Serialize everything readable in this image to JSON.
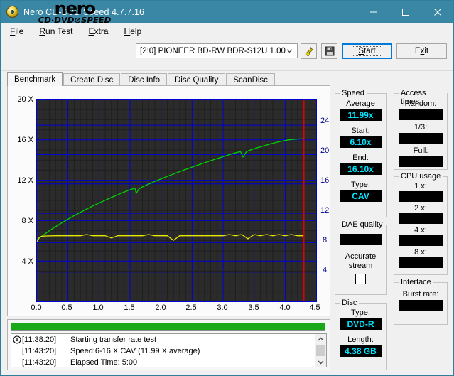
{
  "window": {
    "title": "Nero CD-DVD Speed 4.7.7.16",
    "icon": "nero-disc-icon",
    "minimize": "─",
    "maximize": "□",
    "close": "✕"
  },
  "menu": {
    "items": [
      "File",
      "Run Test",
      "Extra",
      "Help"
    ]
  },
  "toolbar": {
    "logo_main": "nero",
    "logo_sub": "CD·DVD⊘SPEED",
    "drive_value": "[2:0]  PIONEER BD-RW  BDR-S12U 1.00",
    "drive_options": [
      "[2:0]  PIONEER BD-RW  BDR-S12U 1.00"
    ],
    "plug_icon": "plug-icon",
    "save_icon": "floppy-save-icon",
    "start_label": "Start",
    "exit_label": "Exit"
  },
  "tabs": [
    {
      "label": "Benchmark",
      "active": true
    },
    {
      "label": "Create Disc",
      "active": false
    },
    {
      "label": "Disc Info",
      "active": false
    },
    {
      "label": "Disc Quality",
      "active": false
    },
    {
      "label": "ScanDisc",
      "active": false
    }
  ],
  "chart_data": {
    "type": "line",
    "title": "",
    "xlabel": "",
    "ylabel": "",
    "xlim": [
      0,
      4.5
    ],
    "ylim": [
      0,
      20
    ],
    "xticks": [
      "0.0",
      "0.5",
      "1.0",
      "1.5",
      "2.0",
      "2.5",
      "3.0",
      "3.5",
      "4.0",
      "4.5"
    ],
    "yticks_left": [
      "20 X",
      "16 X",
      "12 X",
      "8 X",
      "4 X"
    ],
    "yticks_right": [
      "24",
      "20",
      "16",
      "12",
      "8",
      "4"
    ],
    "right_axis_lim": [
      0,
      27.5
    ],
    "grid": true,
    "legend": "none",
    "plot_bg": "#2b2b2b",
    "grid_color": "#0000d4",
    "series": [
      {
        "name": "Transfer rate",
        "color": "#00d400",
        "x": [
          0.0,
          0.1,
          0.2,
          0.3,
          0.4,
          0.5,
          0.6,
          0.7,
          0.8,
          0.9,
          1.0,
          1.1,
          1.2,
          1.3,
          1.4,
          1.5,
          1.58,
          1.6,
          1.64,
          1.7,
          1.8,
          1.9,
          2.0,
          2.1,
          2.2,
          2.3,
          2.4,
          2.5,
          2.6,
          2.7,
          2.8,
          2.9,
          3.0,
          3.1,
          3.2,
          3.28,
          3.32,
          3.38,
          3.45,
          3.55,
          3.65,
          3.75,
          3.85,
          3.95,
          4.05,
          4.15,
          4.25,
          4.3
        ],
        "y": [
          6.1,
          6.55,
          7.0,
          7.4,
          7.78,
          8.15,
          8.5,
          8.82,
          9.14,
          9.45,
          9.74,
          10.02,
          10.3,
          10.56,
          10.82,
          11.06,
          11.22,
          10.7,
          11.12,
          11.34,
          11.62,
          11.88,
          12.14,
          12.38,
          12.62,
          12.86,
          13.08,
          13.3,
          13.52,
          13.73,
          13.94,
          14.14,
          14.34,
          14.53,
          14.72,
          14.84,
          14.3,
          14.85,
          15.02,
          15.22,
          15.4,
          15.58,
          15.74,
          15.88,
          16.0,
          16.06,
          16.1,
          16.1
        ]
      },
      {
        "name": "CPU / secondary",
        "color": "#e8e800",
        "x": [
          0.0,
          0.04,
          0.08,
          0.15,
          0.3,
          0.5,
          0.7,
          0.8,
          0.9,
          1.0,
          1.1,
          1.2,
          1.3,
          1.4,
          1.5,
          1.6,
          1.7,
          1.8,
          1.9,
          2.0,
          2.1,
          2.2,
          2.3,
          2.4,
          2.5,
          2.6,
          2.7,
          2.8,
          2.9,
          3.0,
          3.1,
          3.2,
          3.3,
          3.4,
          3.5,
          3.6,
          3.7,
          3.8,
          3.9,
          4.0,
          4.1,
          4.2,
          4.3
        ],
        "y": [
          5.9,
          6.35,
          6.45,
          6.48,
          6.5,
          6.5,
          6.5,
          6.62,
          6.5,
          6.5,
          6.5,
          6.28,
          6.5,
          6.5,
          6.5,
          6.5,
          6.5,
          6.62,
          6.5,
          6.5,
          6.5,
          6.05,
          6.5,
          6.5,
          6.5,
          6.5,
          6.5,
          6.5,
          6.5,
          6.5,
          6.62,
          6.5,
          6.62,
          6.2,
          6.62,
          6.5,
          6.62,
          6.5,
          6.62,
          6.5,
          6.62,
          6.5,
          6.5
        ]
      }
    ],
    "marker_line": {
      "x": 4.3,
      "color": "#e00000"
    }
  },
  "speed": {
    "caption": "Speed",
    "average_label": "Average",
    "average_value": "11.99x",
    "start_label": "Start:",
    "start_value": "6.10x",
    "end_label": "End:",
    "end_value": "16.10x",
    "type_label": "Type:",
    "type_value": "CAV"
  },
  "access_times": {
    "caption": "Access times",
    "random_label": "Random:",
    "random_value": "",
    "third_label": "1/3:",
    "third_value": "",
    "full_label": "Full:",
    "full_value": ""
  },
  "cpu_usage": {
    "caption": "CPU usage",
    "rows": [
      {
        "label": "1 x:",
        "value": ""
      },
      {
        "label": "2 x:",
        "value": ""
      },
      {
        "label": "4 x:",
        "value": ""
      },
      {
        "label": "8 x:",
        "value": ""
      }
    ]
  },
  "dae_quality": {
    "caption": "DAE quality",
    "value": "",
    "accurate_line1": "Accurate",
    "accurate_line2": "stream",
    "accurate_checked": false
  },
  "disc": {
    "caption": "Disc",
    "type_label": "Type:",
    "type_value": "DVD-R",
    "length_label": "Length:",
    "length_value": "4.38 GB"
  },
  "interface": {
    "caption": "Interface",
    "burst_label": "Burst rate:",
    "burst_value": ""
  },
  "bottom": {
    "progress_percent": 100,
    "progress_color": "#18a818",
    "log": [
      {
        "icon": "info-icon",
        "time": "[11:38:20]",
        "message": "Starting transfer rate test"
      },
      {
        "icon": "",
        "time": "[11:43:20]",
        "message": "Speed:6-16 X CAV (11.99 X average)"
      },
      {
        "icon": "",
        "time": "[11:43:20]",
        "message": "Elapsed Time:  5:00"
      }
    ],
    "scroll_up": "▲",
    "scroll_down": "▼"
  }
}
